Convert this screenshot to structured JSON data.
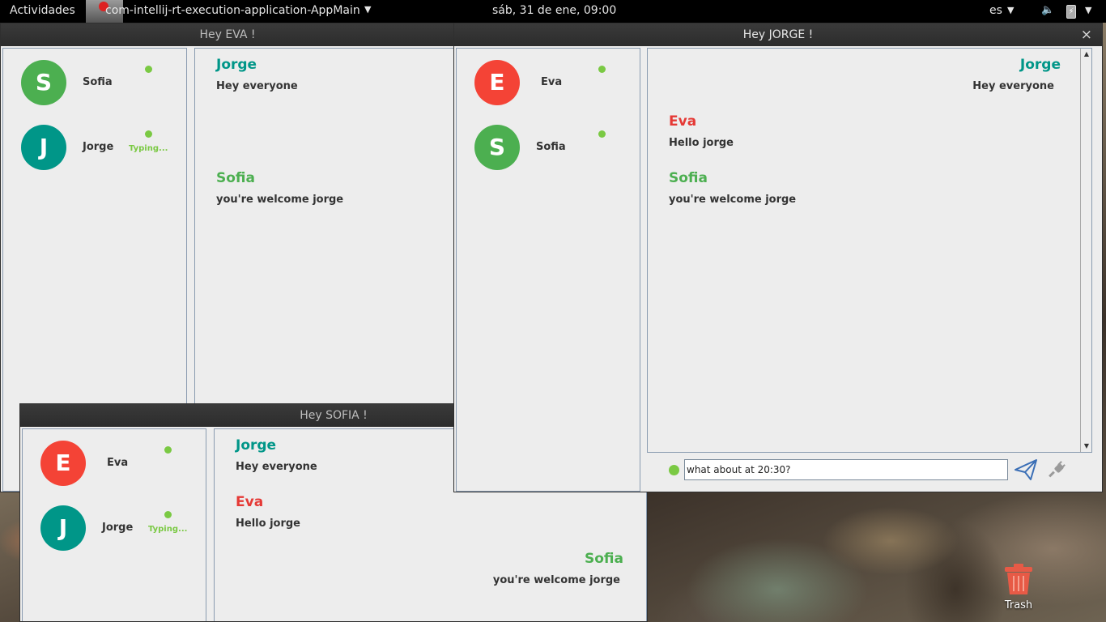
{
  "topbar": {
    "activities": "Actividades",
    "app_name": "com-intellij-rt-execution-application-AppMain",
    "clock": "sáb, 31 de ene, 09:00",
    "language": "es"
  },
  "colors": {
    "green_avatar": "#4caf50",
    "teal_avatar": "#009688",
    "red_avatar": "#f44336",
    "jorge_name": "#009688",
    "sofia_name": "#4caf50",
    "eva_name": "#e53935",
    "online": "#7ac943"
  },
  "windows": {
    "eva": {
      "title": "Hey EVA !",
      "contacts": [
        {
          "initial": "S",
          "name": "Sofia",
          "status": ""
        },
        {
          "initial": "J",
          "name": "Jorge",
          "status": "Typing..."
        }
      ],
      "messages": [
        {
          "sender": "Jorge",
          "text": "Hey everyone"
        },
        {
          "sender": "Sofia",
          "text": "you're welcome jorge"
        }
      ]
    },
    "jorge": {
      "title": "Hey JORGE !",
      "close_label": "×",
      "contacts": [
        {
          "initial": "E",
          "name": "Eva",
          "status": ""
        },
        {
          "initial": "S",
          "name": "Sofia",
          "status": ""
        }
      ],
      "messages": [
        {
          "sender": "Jorge",
          "text": "Hey everyone"
        },
        {
          "sender": "Eva",
          "text": "Hello jorge"
        },
        {
          "sender": "Sofia",
          "text": "you're welcome jorge"
        }
      ],
      "input_value": "what about at 20:30?"
    },
    "sofia": {
      "title": "Hey SOFIA !",
      "contacts": [
        {
          "initial": "E",
          "name": "Eva",
          "status": ""
        },
        {
          "initial": "J",
          "name": "Jorge",
          "status": "Typing..."
        }
      ],
      "messages": [
        {
          "sender": "Jorge",
          "text": "Hey everyone"
        },
        {
          "sender": "Eva",
          "text": "Hello jorge"
        },
        {
          "sender": "Sofia",
          "text": "you're welcome jorge"
        }
      ]
    }
  },
  "desktop": {
    "trash_label": "Trash"
  }
}
